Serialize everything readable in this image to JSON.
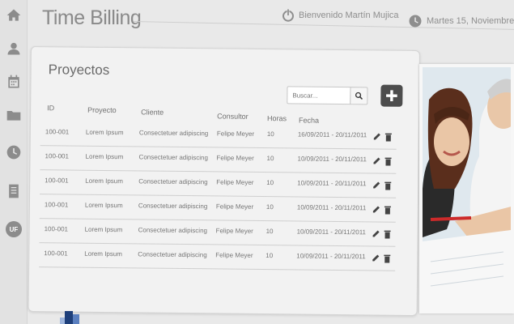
{
  "header": {
    "title": "Time Billing",
    "welcome": "Bienvenido Martín Mujica",
    "date": "Martes 15, Noviembre"
  },
  "sidebar": {
    "items": [
      {
        "icon": "home-icon"
      },
      {
        "icon": "user-icon"
      },
      {
        "icon": "calendar-icon"
      },
      {
        "icon": "folder-icon"
      },
      {
        "icon": "clock-icon"
      },
      {
        "icon": "document-icon"
      },
      {
        "icon": "uf-badge-icon",
        "label": "UF"
      }
    ]
  },
  "projects": {
    "title": "Proyectos",
    "search_placeholder": "Buscar...",
    "columns": {
      "id": "ID",
      "proyecto": "Proyecto",
      "cliente": "Cliente",
      "consultor": "Consultor",
      "horas": "Horas",
      "fecha": "Fecha"
    },
    "rows": [
      {
        "id": "100-001",
        "proyecto": "Lorem Ipsum",
        "cliente": "Consectetuer adipiscing",
        "consultor": "Felipe Meyer",
        "horas": "10",
        "fecha": "16/09/2011  - 20/11/2011"
      },
      {
        "id": "100-001",
        "proyecto": "Lorem Ipsum",
        "cliente": "Consectetuer adipiscing",
        "consultor": "Felipe Meyer",
        "horas": "10",
        "fecha": "10/09/2011  - 20/11/2011"
      },
      {
        "id": "100-001",
        "proyecto": "Lorem Ipsum",
        "cliente": "Consectetuer adipiscing",
        "consultor": "Felipe Meyer",
        "horas": "10",
        "fecha": "10/09/2011  - 20/11/2011"
      },
      {
        "id": "100-001",
        "proyecto": "Lorem Ipsum",
        "cliente": "Consectetuer adipiscing",
        "consultor": "Felipe Meyer",
        "horas": "10",
        "fecha": "10/09/2011  - 20/11/2011"
      },
      {
        "id": "100-001",
        "proyecto": "Lorem Ipsum",
        "cliente": "Consectetuer adipiscing",
        "consultor": "Felipe Meyer",
        "horas": "10",
        "fecha": "10/09/2011  - 20/11/2011"
      },
      {
        "id": "100-001",
        "proyecto": "Lorem Ipsum",
        "cliente": "Consectetuer adipiscing",
        "consultor": "Felipe Meyer",
        "horas": "10",
        "fecha": "10/09/2011  - 20/11/2011"
      }
    ]
  },
  "colors": {
    "sidebar_bg": "#e2e2e2",
    "panel_bg": "#f2f2f2",
    "add_button_bg": "#4d4d4d",
    "text_gray": "#8a8a8a"
  }
}
